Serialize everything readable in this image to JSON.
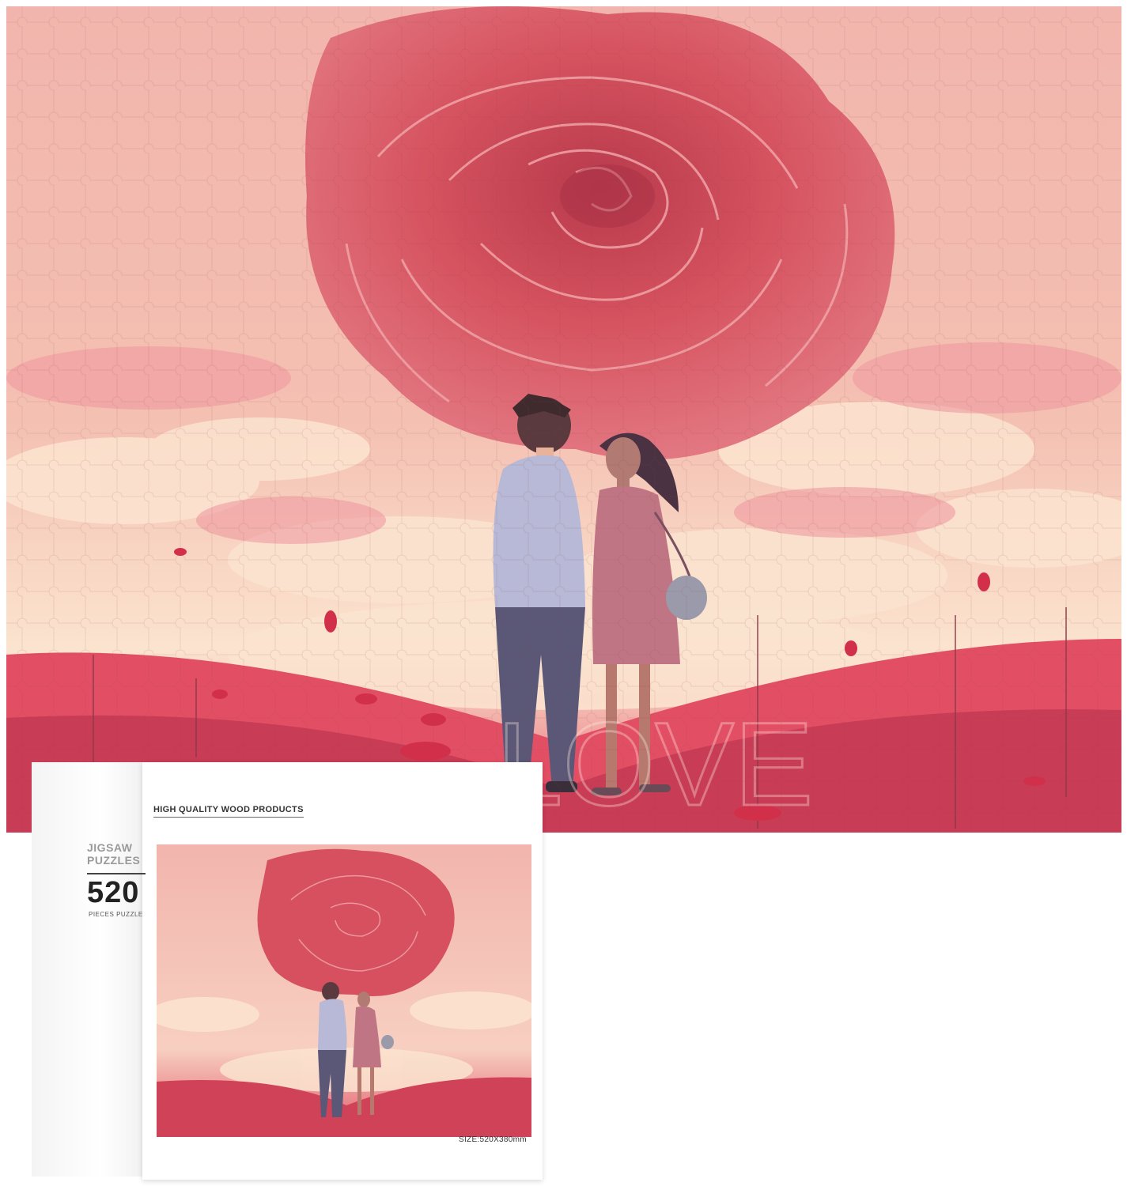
{
  "box": {
    "tagline": "HIGH QUALITY WOOD PRODUCTS",
    "type_line1": "JIGSAW",
    "type_line2": "PUZZLES",
    "piece_count": "520",
    "piece_sub": "PIECES PUZZLE",
    "size": "SIZE:520X380mm"
  },
  "colors": {
    "sky": "#f2b7ae",
    "rose": "#d9505e",
    "cloud": "#fbe6d2",
    "ground": "#d94a5e"
  }
}
